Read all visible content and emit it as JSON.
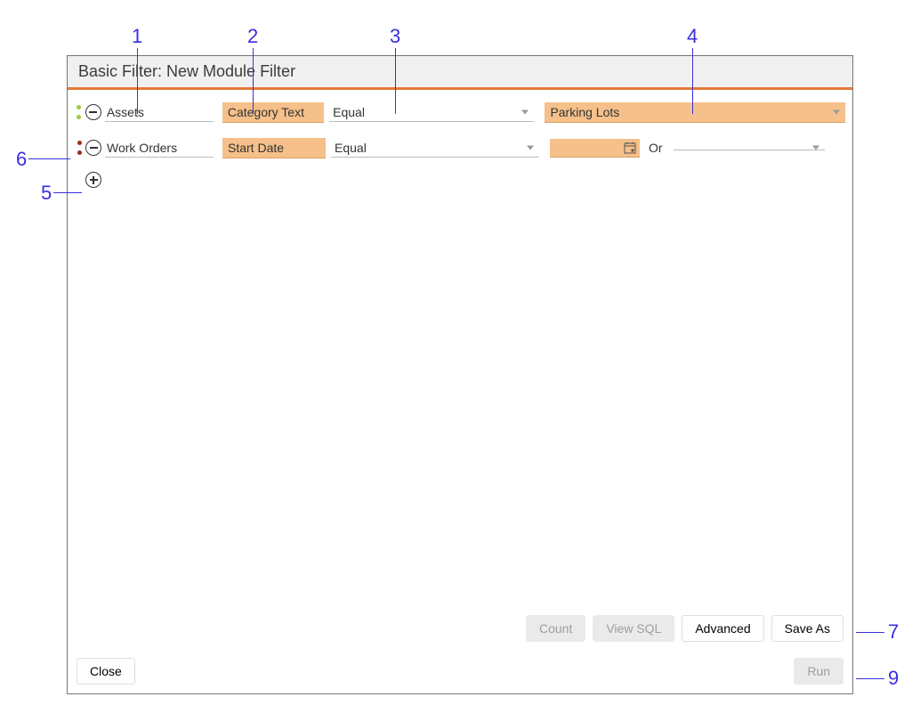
{
  "dialog": {
    "title": "Basic Filter: New Module Filter"
  },
  "rows": [
    {
      "module": "Assets",
      "field": "Category Text",
      "operator": "Equal",
      "value": "Parking Lots",
      "dotColor": "green"
    },
    {
      "module": "Work Orders",
      "field": "Start Date",
      "operator": "Equal",
      "orLabel": "Or",
      "dotColor": "red"
    }
  ],
  "buttons": {
    "count": "Count",
    "viewSql": "View SQL",
    "advanced": "Advanced",
    "saveAs": "Save As",
    "close": "Close",
    "run": "Run"
  },
  "callouts": {
    "1": "1",
    "2": "2",
    "3": "3",
    "4": "4",
    "5": "5",
    "6": "6",
    "7": "7",
    "9": "9"
  }
}
